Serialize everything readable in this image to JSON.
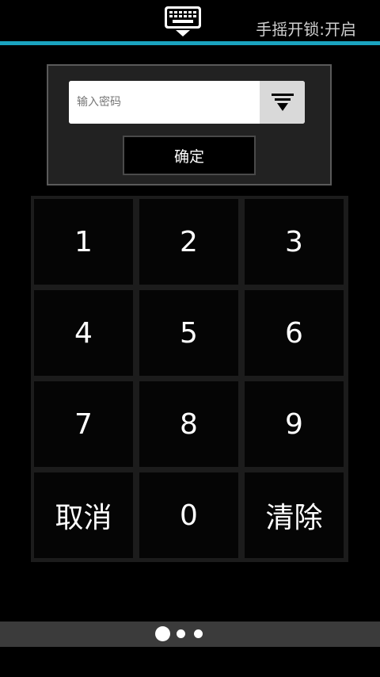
{
  "header": {
    "keyboard_icon": "keyboard-icon",
    "shake_status": "手摇开锁:开启",
    "accent_color": "#1aa3c0"
  },
  "password": {
    "placeholder": "输入密码",
    "value": "",
    "dropdown_icon": "filter-funnel-icon",
    "confirm_label": "确定"
  },
  "keypad": {
    "keys": [
      "1",
      "2",
      "3",
      "4",
      "5",
      "6",
      "7",
      "8",
      "9",
      "取消",
      "0",
      "清除"
    ]
  },
  "pager": {
    "page_count": 3,
    "current_page": 1
  }
}
